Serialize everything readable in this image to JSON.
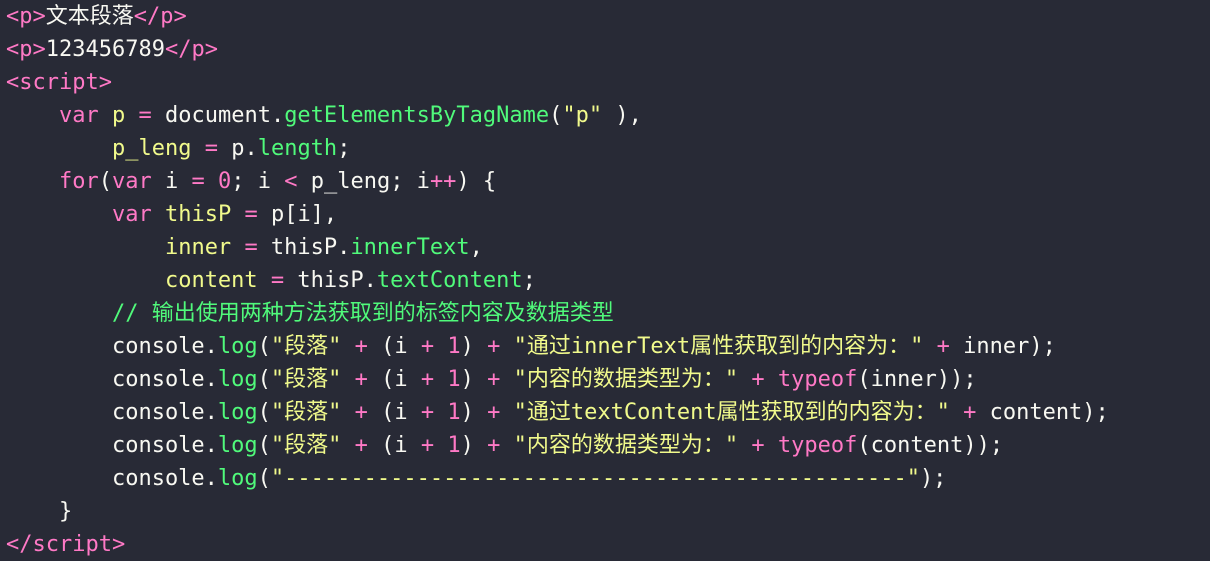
{
  "editor": {
    "lines": [
      [
        [
          "tag",
          "<"
        ],
        [
          "keyword",
          "p"
        ],
        [
          "tag",
          ">"
        ],
        [
          "text",
          "文本段落"
        ],
        [
          "tag",
          "</"
        ],
        [
          "keyword",
          "p"
        ],
        [
          "tag",
          ">"
        ]
      ],
      [
        [
          "tag",
          "<"
        ],
        [
          "keyword",
          "p"
        ],
        [
          "tag",
          ">"
        ],
        [
          "text",
          "123456789"
        ],
        [
          "tag",
          "</"
        ],
        [
          "keyword",
          "p"
        ],
        [
          "tag",
          ">"
        ]
      ],
      [
        [
          "tag",
          "<"
        ],
        [
          "keyword",
          "script"
        ],
        [
          "tag",
          ">"
        ]
      ],
      [
        [
          "text",
          "    "
        ],
        [
          "keyword",
          "var"
        ],
        [
          "text",
          " "
        ],
        [
          "decl",
          "p"
        ],
        [
          "text",
          " "
        ],
        [
          "op",
          "="
        ],
        [
          "text",
          " document."
        ],
        [
          "func",
          "getElementsByTagName"
        ],
        [
          "punc",
          "("
        ],
        [
          "string",
          "\"p\""
        ],
        [
          "punc",
          " ),"
        ]
      ],
      [
        [
          "text",
          "        "
        ],
        [
          "decl",
          "p_leng"
        ],
        [
          "text",
          " "
        ],
        [
          "op",
          "="
        ],
        [
          "text",
          " p."
        ],
        [
          "prop",
          "length"
        ],
        [
          "punc",
          ";"
        ]
      ],
      [
        [
          "text",
          "    "
        ],
        [
          "keyword",
          "for"
        ],
        [
          "punc",
          "("
        ],
        [
          "keyword",
          "var"
        ],
        [
          "text",
          " i "
        ],
        [
          "op",
          "="
        ],
        [
          "text",
          " "
        ],
        [
          "number",
          "0"
        ],
        [
          "punc",
          "; i "
        ],
        [
          "op",
          "<"
        ],
        [
          "text",
          " p_leng"
        ],
        [
          "punc",
          "; i"
        ],
        [
          "op",
          "++"
        ],
        [
          "punc",
          ") {"
        ]
      ],
      [
        [
          "text",
          "        "
        ],
        [
          "keyword",
          "var"
        ],
        [
          "text",
          " "
        ],
        [
          "decl",
          "thisP"
        ],
        [
          "text",
          " "
        ],
        [
          "op",
          "="
        ],
        [
          "text",
          " p[i],"
        ]
      ],
      [
        [
          "text",
          "            "
        ],
        [
          "decl",
          "inner"
        ],
        [
          "text",
          " "
        ],
        [
          "op",
          "="
        ],
        [
          "text",
          " thisP."
        ],
        [
          "prop",
          "innerText"
        ],
        [
          "punc",
          ","
        ]
      ],
      [
        [
          "text",
          "            "
        ],
        [
          "decl",
          "content"
        ],
        [
          "text",
          " "
        ],
        [
          "op",
          "="
        ],
        [
          "text",
          " thisP."
        ],
        [
          "prop",
          "textContent"
        ],
        [
          "punc",
          ";"
        ]
      ],
      [
        [
          "text",
          "        "
        ],
        [
          "comment",
          "// 输出使用两种方法获取到的标签内容及数据类型"
        ]
      ],
      [
        [
          "text",
          "        console."
        ],
        [
          "func",
          "log"
        ],
        [
          "punc",
          "("
        ],
        [
          "string",
          "\"段落\""
        ],
        [
          "text",
          " "
        ],
        [
          "op",
          "+"
        ],
        [
          "text",
          " (i "
        ],
        [
          "op",
          "+"
        ],
        [
          "text",
          " "
        ],
        [
          "number",
          "1"
        ],
        [
          "text",
          ") "
        ],
        [
          "op",
          "+"
        ],
        [
          "text",
          " "
        ],
        [
          "string",
          "\"通过innerText属性获取到的内容为：\""
        ],
        [
          "text",
          " "
        ],
        [
          "op",
          "+"
        ],
        [
          "text",
          " inner);"
        ]
      ],
      [
        [
          "text",
          "        console."
        ],
        [
          "func",
          "log"
        ],
        [
          "punc",
          "("
        ],
        [
          "string",
          "\"段落\""
        ],
        [
          "text",
          " "
        ],
        [
          "op",
          "+"
        ],
        [
          "text",
          " (i "
        ],
        [
          "op",
          "+"
        ],
        [
          "text",
          " "
        ],
        [
          "number",
          "1"
        ],
        [
          "text",
          ") "
        ],
        [
          "op",
          "+"
        ],
        [
          "text",
          " "
        ],
        [
          "string",
          "\"内容的数据类型为：\""
        ],
        [
          "text",
          " "
        ],
        [
          "op",
          "+"
        ],
        [
          "text",
          " "
        ],
        [
          "keyword",
          "typeof"
        ],
        [
          "punc",
          "("
        ],
        [
          "text",
          "inner));"
        ]
      ],
      [
        [
          "text",
          "        console."
        ],
        [
          "func",
          "log"
        ],
        [
          "punc",
          "("
        ],
        [
          "string",
          "\"段落\""
        ],
        [
          "text",
          " "
        ],
        [
          "op",
          "+"
        ],
        [
          "text",
          " (i "
        ],
        [
          "op",
          "+"
        ],
        [
          "text",
          " "
        ],
        [
          "number",
          "1"
        ],
        [
          "text",
          ") "
        ],
        [
          "op",
          "+"
        ],
        [
          "text",
          " "
        ],
        [
          "string",
          "\"通过textContent属性获取到的内容为：\""
        ],
        [
          "text",
          " "
        ],
        [
          "op",
          "+"
        ],
        [
          "text",
          " content);"
        ]
      ],
      [
        [
          "text",
          "        console."
        ],
        [
          "func",
          "log"
        ],
        [
          "punc",
          "("
        ],
        [
          "string",
          "\"段落\""
        ],
        [
          "text",
          " "
        ],
        [
          "op",
          "+"
        ],
        [
          "text",
          " (i "
        ],
        [
          "op",
          "+"
        ],
        [
          "text",
          " "
        ],
        [
          "number",
          "1"
        ],
        [
          "text",
          ") "
        ],
        [
          "op",
          "+"
        ],
        [
          "text",
          " "
        ],
        [
          "string",
          "\"内容的数据类型为：\""
        ],
        [
          "text",
          " "
        ],
        [
          "op",
          "+"
        ],
        [
          "text",
          " "
        ],
        [
          "keyword",
          "typeof"
        ],
        [
          "punc",
          "("
        ],
        [
          "text",
          "content));"
        ]
      ],
      [
        [
          "text",
          "        console."
        ],
        [
          "func",
          "log"
        ],
        [
          "punc",
          "("
        ],
        [
          "string",
          "\"-----------------------------------------------\""
        ],
        [
          "text",
          ");"
        ]
      ],
      [
        [
          "text",
          "    }"
        ]
      ],
      [
        [
          "tag",
          "</"
        ],
        [
          "keyword",
          "script"
        ],
        [
          "tag",
          ">"
        ]
      ]
    ]
  }
}
